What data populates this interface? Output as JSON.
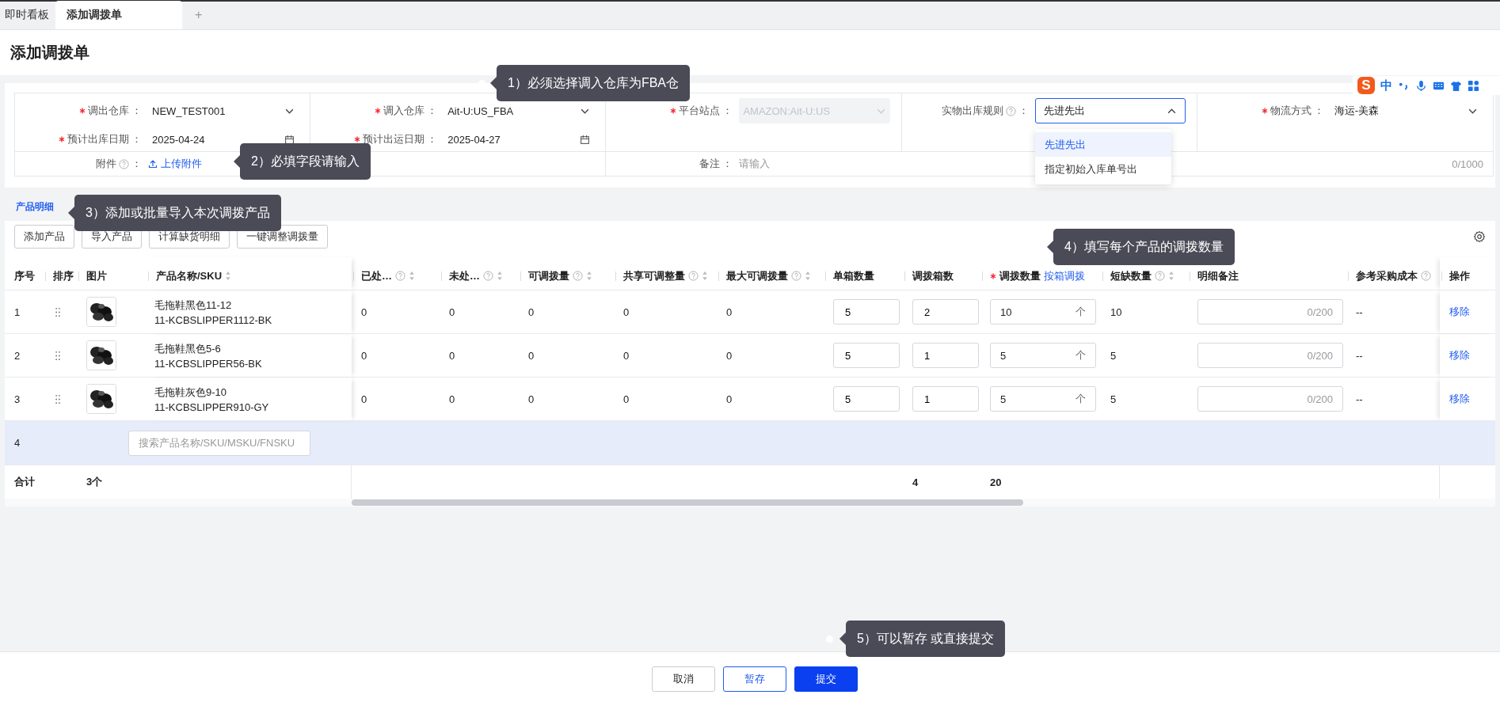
{
  "tabs": [
    {
      "label": "即时看板",
      "selected": false
    },
    {
      "label": "添加调拨单",
      "selected": true
    }
  ],
  "add_tab": "+",
  "title": "添加调拨单",
  "ime_toolbar": {
    "logo": "S",
    "mode": "中"
  },
  "form": {
    "columns": [
      {
        "fields": [
          {
            "label": "调出仓库",
            "colon": "：",
            "required": true,
            "help": false,
            "kind": "select",
            "value": "NEW_TEST001",
            "disabled": false,
            "open": false
          },
          {
            "label": "预计出库日期",
            "colon": "：",
            "required": true,
            "help": false,
            "kind": "date",
            "value": "2025-04-24"
          }
        ]
      },
      {
        "fields": [
          {
            "label": "调入仓库",
            "colon": "：",
            "required": true,
            "help": false,
            "kind": "select",
            "value": "Ait-U:US_FBA",
            "disabled": false,
            "open": false
          },
          {
            "label": "预计出运日期",
            "colon": "：",
            "required": true,
            "help": false,
            "kind": "date",
            "value": "2025-04-27"
          }
        ]
      },
      {
        "fields": [
          {
            "label": "平台站点",
            "colon": "：",
            "required": true,
            "help": false,
            "kind": "select",
            "value": "AMAZON:Ait-U:US",
            "disabled": true,
            "open": false
          }
        ]
      },
      {
        "fields": [
          {
            "label": "实物出库规则",
            "colon": "：",
            "required": false,
            "help": true,
            "kind": "select",
            "value": "先进先出",
            "disabled": false,
            "open": true,
            "options": [
              {
                "label": "先进先出",
                "selected": true
              },
              {
                "label": "指定初始入库单号出",
                "selected": false
              }
            ]
          }
        ]
      },
      {
        "fields": [
          {
            "label": "物流方式",
            "colon": "：",
            "required": true,
            "help": false,
            "kind": "select",
            "value": "海运-美森",
            "disabled": false,
            "open": false
          }
        ]
      }
    ],
    "bottom": [
      {
        "label": "附件",
        "colon": "：",
        "required": false,
        "help": true,
        "kind": "upload",
        "value": "上传附件"
      },
      {
        "label": "备注",
        "colon": "：",
        "required": false,
        "help": false,
        "kind": "text",
        "placeholder": "请输入",
        "counter": "0/1000"
      }
    ]
  },
  "section_title": "产品明细",
  "toolbar": [
    "添加产品",
    "导入产品",
    "计算缺货明细",
    "一键调整调拨量"
  ],
  "table": {
    "columns": [
      {
        "label": "序号",
        "help": false,
        "sortable": false,
        "required": false
      },
      {
        "label": "排序",
        "help": false,
        "sortable": false,
        "required": false
      },
      {
        "label": "图片",
        "help": false,
        "sortable": false,
        "required": false
      },
      {
        "label": "产品名称/SKU",
        "help": false,
        "sortable": true,
        "required": false
      },
      {
        "label": "已处…",
        "help": true,
        "sortable": true,
        "required": false
      },
      {
        "label": "未处…",
        "help": true,
        "sortable": true,
        "required": false
      },
      {
        "label": "可调拨量",
        "help": true,
        "sortable": true,
        "required": false
      },
      {
        "label": "共享可调整量",
        "help": true,
        "sortable": true,
        "required": false
      },
      {
        "label": "最大可调拨量",
        "help": true,
        "sortable": true,
        "required": false
      },
      {
        "label": "单箱数量",
        "help": false,
        "sortable": false,
        "required": false
      },
      {
        "label": "调拨箱数",
        "help": false,
        "sortable": false,
        "required": false
      },
      {
        "label": "调拨数量",
        "help": false,
        "sortable": false,
        "required": true,
        "link": "按箱调拨"
      },
      {
        "label": "短缺数量",
        "help": true,
        "sortable": true,
        "required": false
      },
      {
        "label": "明细备注",
        "help": false,
        "sortable": false,
        "required": false
      },
      {
        "label": "参考采购成本",
        "help": true,
        "sortable": false,
        "required": false
      },
      {
        "label": "操作",
        "help": false,
        "sortable": false,
        "required": false
      }
    ],
    "rows": [
      {
        "no": "1",
        "name": "毛拖鞋黑色11-12",
        "sku": "11-KCBSLIPPER1112-BK",
        "processed": "0",
        "unprocessed": "0",
        "available": "0",
        "shared": "0",
        "max": "0",
        "per_box": "5",
        "boxes": "2",
        "quantity": "10",
        "unit": "个",
        "shortage": "10",
        "note_counter": "0/200",
        "cost": "--",
        "action": "移除"
      },
      {
        "no": "2",
        "name": "毛拖鞋黑色5-6",
        "sku": "11-KCBSLIPPER56-BK",
        "processed": "0",
        "unprocessed": "0",
        "available": "0",
        "shared": "0",
        "max": "0",
        "per_box": "5",
        "boxes": "1",
        "quantity": "5",
        "unit": "个",
        "shortage": "5",
        "note_counter": "0/200",
        "cost": "--",
        "action": "移除"
      },
      {
        "no": "3",
        "name": "毛拖鞋灰色9-10",
        "sku": "11-KCBSLIPPER910-GY",
        "processed": "0",
        "unprocessed": "0",
        "available": "0",
        "shared": "0",
        "max": "0",
        "per_box": "5",
        "boxes": "1",
        "quantity": "5",
        "unit": "个",
        "shortage": "5",
        "note_counter": "0/200",
        "cost": "--",
        "action": "移除"
      }
    ],
    "new_row": {
      "no": "4",
      "selected": true,
      "placeholder": "搜索产品名称/SKU/MSKU/FNSKU"
    },
    "total": {
      "label": "合计",
      "count": "3个",
      "boxes": "4",
      "quantity": "20"
    }
  },
  "tooltips": [
    {
      "text": "1）必须选择调入仓库为FBA仓",
      "dot": true
    },
    {
      "text": "2）必填字段请输入",
      "dot": false
    },
    {
      "text": "3）添加或批量导入本次调拨产品",
      "dot": false
    },
    {
      "text": "4）填写每个产品的调拨数量",
      "dot": false
    },
    {
      "text": "5）可以暂存 或直接提交",
      "dot": true
    }
  ],
  "footer": [
    {
      "label": "取消",
      "kind": "default"
    },
    {
      "label": "暂存",
      "kind": "outline"
    },
    {
      "label": "提交",
      "kind": "primary"
    }
  ]
}
